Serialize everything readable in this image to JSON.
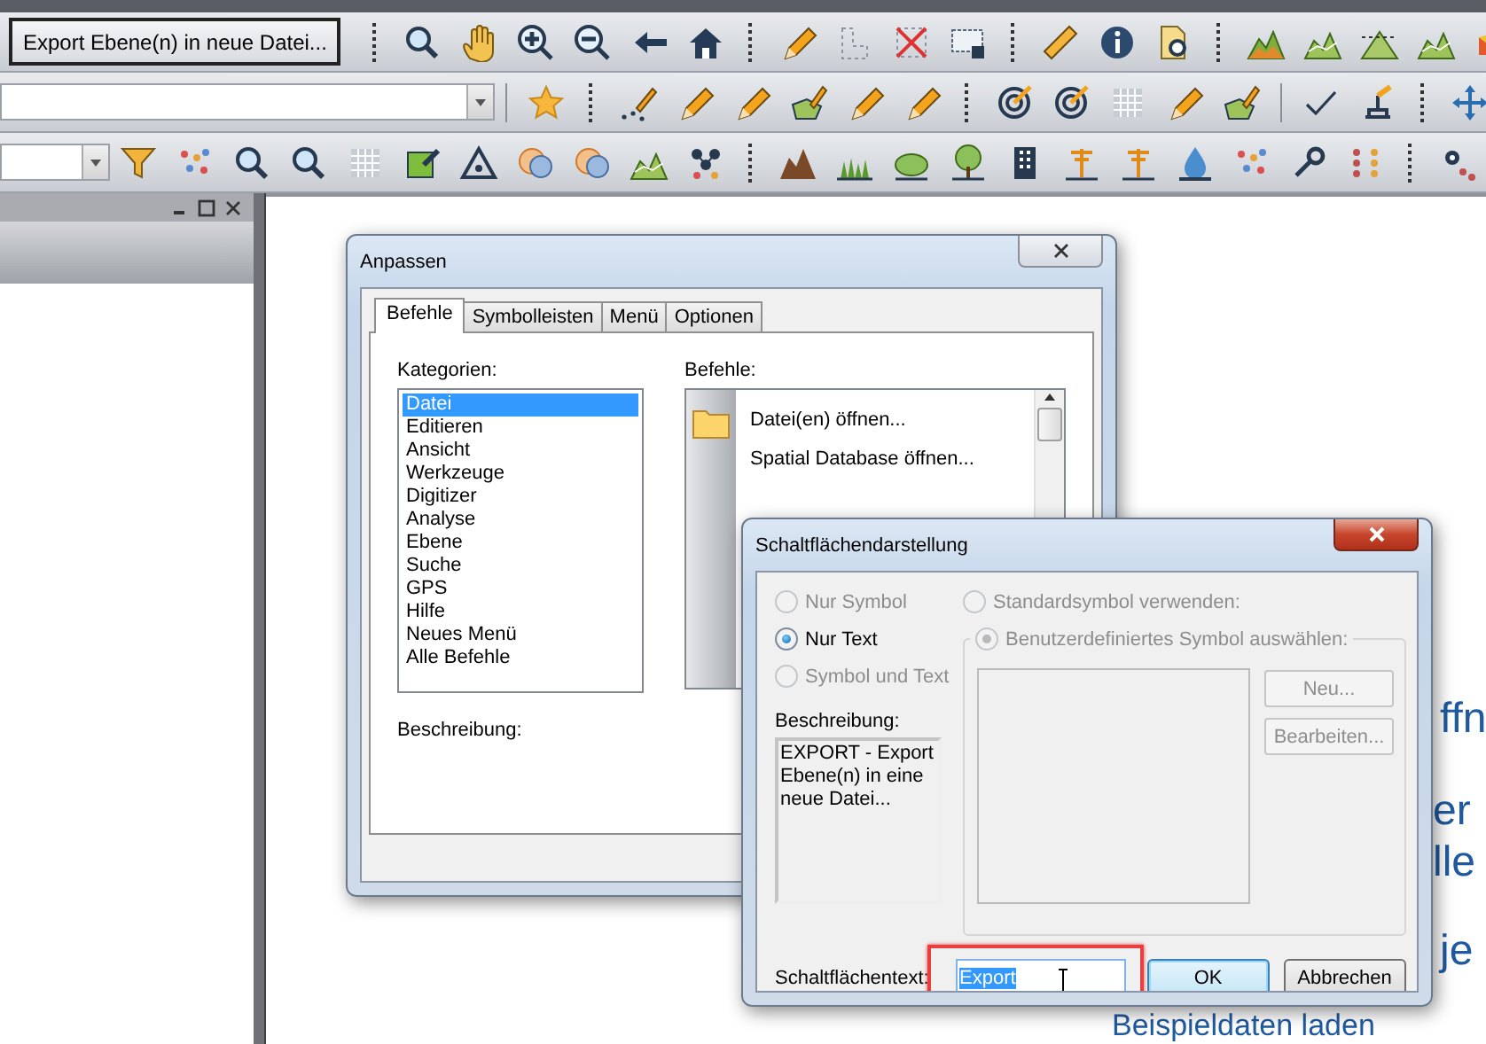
{
  "toolbar": {
    "command_button": "Export Ebene(n) in neue Datei..."
  },
  "customize_dialog": {
    "title": "Anpassen",
    "tabs": [
      {
        "label": "Befehle",
        "selected": true
      },
      {
        "label": "Symbolleisten",
        "selected": false
      },
      {
        "label": "Menü",
        "selected": false
      },
      {
        "label": "Optionen",
        "selected": false
      }
    ],
    "categories_label": "Kategorien:",
    "categories": [
      {
        "label": "Datei",
        "selected": true
      },
      {
        "label": "Editieren",
        "selected": false
      },
      {
        "label": "Ansicht",
        "selected": false
      },
      {
        "label": "Werkzeuge",
        "selected": false
      },
      {
        "label": "Digitizer",
        "selected": false
      },
      {
        "label": "Analyse",
        "selected": false
      },
      {
        "label": "Ebene",
        "selected": false
      },
      {
        "label": "Suche",
        "selected": false
      },
      {
        "label": "GPS",
        "selected": false
      },
      {
        "label": "Hilfe",
        "selected": false
      },
      {
        "label": "Neues Menü",
        "selected": false
      },
      {
        "label": "Alle Befehle",
        "selected": false
      }
    ],
    "commands_label": "Befehle:",
    "commands": [
      {
        "label": "Datei(en) öffnen...",
        "kind": "folder"
      },
      {
        "label": "Spatial Database öffnen...",
        "kind": "plain"
      }
    ],
    "description_label": "Beschreibung:"
  },
  "button_dialog": {
    "title": "Schaltflächendarstellung",
    "display_options": [
      {
        "label": "Nur Symbol",
        "selected": false,
        "disabled": true
      },
      {
        "label": "Nur Text",
        "selected": true,
        "disabled": false
      },
      {
        "label": "Symbol und Text",
        "selected": false,
        "disabled": true
      }
    ],
    "symbol_options": [
      {
        "label": "Standardsymbol verwenden:",
        "selected": false,
        "disabled": true
      },
      {
        "label": "Benutzerdefiniertes Symbol auswählen:",
        "selected": true,
        "disabled": true
      }
    ],
    "symbol_buttons": [
      {
        "label": "Neu...",
        "disabled": true
      },
      {
        "label": "Bearbeiten...",
        "disabled": true
      }
    ],
    "description_label": "Beschreibung:",
    "description": "EXPORT - Export Ebene(n) in eine neue Datei...",
    "button_text_label": "Schaltflächentext:",
    "button_text": {
      "value": "Export",
      "highlighted": true
    },
    "buttons": [
      {
        "label": "OK",
        "default": true
      },
      {
        "label": "Abbrechen",
        "default": false
      }
    ]
  },
  "background_page": {
    "text_fragments": [
      "ffn",
      "er",
      "lle",
      "je"
    ],
    "link_text": "Beispieldaten laden"
  }
}
